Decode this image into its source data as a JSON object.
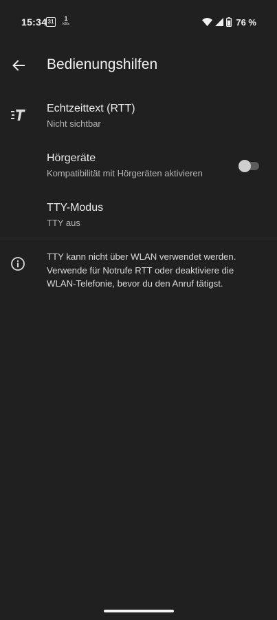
{
  "status_bar": {
    "time": "15:34",
    "calendar_day": "31",
    "data_rate_value": "1",
    "data_rate_unit": "kB/s",
    "battery_percent": "76 %"
  },
  "toolbar": {
    "title": "Bedienungshilfen"
  },
  "settings": {
    "rtt": {
      "title": "Echtzeittext (RTT)",
      "subtitle": "Nicht sichtbar"
    },
    "hearing_aids": {
      "title": "Hörgeräte",
      "subtitle": "Kompatibilität mit Hörgeräten aktivieren",
      "enabled": false
    },
    "tty": {
      "title": "TTY-Modus",
      "subtitle": "TTY aus"
    }
  },
  "info": {
    "text": "TTY kann nicht über WLAN verwendet werden. Verwende für Notrufe RTT oder deaktiviere die WLAN-Telefonie, bevor du den Anruf tätigst."
  },
  "icons": {
    "back": "arrow-left-icon",
    "rtt": "rtt-text-icon",
    "info": "info-icon",
    "wifi": "wifi-icon",
    "signal": "cell-signal-icon",
    "battery": "battery-icon"
  },
  "colors": {
    "background": "#202020",
    "text_primary": "#ececec",
    "text_secondary": "#b5b5b5",
    "toggle_off_track": "#5c5c5c",
    "toggle_off_thumb": "#cfcfcf"
  }
}
